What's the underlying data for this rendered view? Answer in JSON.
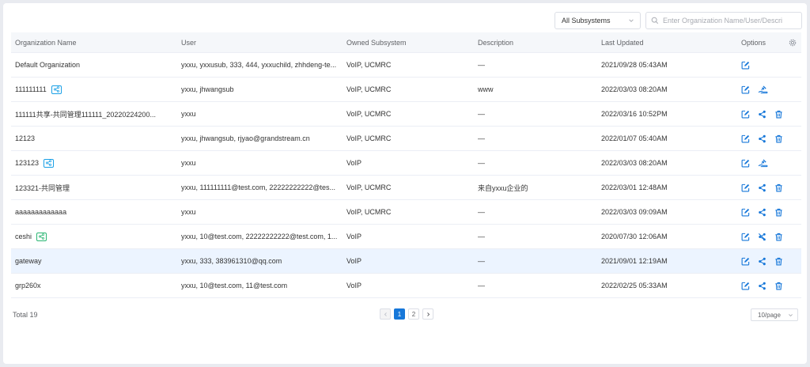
{
  "toolbar": {
    "subsystem_select": "All Subsystems",
    "search_placeholder": "Enter Organization Name/User/Descri"
  },
  "table": {
    "headers": {
      "org": "Organization Name",
      "user": "User",
      "subsystem": "Owned Subsystem",
      "description": "Description",
      "updated": "Last Updated",
      "options": "Options"
    },
    "rows": [
      {
        "name": "Default Organization",
        "badge": "",
        "user": "yxxu, yxxusub, 333, 444, yxxuchild, zhhdeng-te...",
        "subsystem": "VoIP, UCMRC",
        "description": "—",
        "updated": "2021/09/28 05:43AM",
        "actions": [
          "edit"
        ]
      },
      {
        "name": "111111111",
        "badge": "blue",
        "user": "yxxu, jhwangsub",
        "subsystem": "VoIP, UCMRC",
        "description": "www",
        "updated": "2022/03/03 08:20AM",
        "actions": [
          "edit",
          "handover"
        ]
      },
      {
        "name": "111111共享-共同管理111111_20220224200...",
        "badge": "",
        "user": "yxxu",
        "subsystem": "VoIP, UCMRC",
        "description": "—",
        "updated": "2022/03/16 10:52PM",
        "actions": [
          "edit",
          "share",
          "delete"
        ]
      },
      {
        "name": "12123",
        "badge": "",
        "user": "yxxu, jhwangsub, rjyao@grandstream.cn",
        "subsystem": "VoIP, UCMRC",
        "description": "—",
        "updated": "2022/01/07 05:40AM",
        "actions": [
          "edit",
          "share",
          "delete"
        ]
      },
      {
        "name": "123123",
        "badge": "blue",
        "user": "yxxu",
        "subsystem": "VoIP",
        "description": "—",
        "updated": "2022/03/03 08:20AM",
        "actions": [
          "edit",
          "handover"
        ]
      },
      {
        "name": "123321-共同管理",
        "badge": "",
        "user": "yxxu, 111111111@test.com, 22222222222@tes...",
        "subsystem": "VoIP, UCMRC",
        "description": "来自yxxu企业的",
        "updated": "2022/03/01 12:48AM",
        "actions": [
          "edit",
          "share",
          "delete"
        ]
      },
      {
        "name": "aaaaaaaaaaaaa",
        "badge": "",
        "user": "yxxu",
        "subsystem": "VoIP, UCMRC",
        "description": "—",
        "updated": "2022/03/03 09:09AM",
        "actions": [
          "edit",
          "share",
          "delete"
        ]
      },
      {
        "name": "ceshi",
        "badge": "green",
        "user": "yxxu, 10@test.com, 22222222222@test.com, 1...",
        "subsystem": "VoIP",
        "description": "—",
        "updated": "2020/07/30 12:06AM",
        "actions": [
          "edit",
          "unshare",
          "delete"
        ]
      },
      {
        "name": "gateway",
        "badge": "",
        "user": "yxxu, 333, 383961310@qq.com",
        "subsystem": "VoIP",
        "description": "—",
        "updated": "2021/09/01 12:19AM",
        "actions": [
          "edit",
          "share",
          "delete"
        ]
      },
      {
        "name": "grp260x",
        "badge": "",
        "user": "yxxu, 10@test.com, 11@test.com",
        "subsystem": "VoIP",
        "description": "—",
        "updated": "2022/02/25 05:33AM",
        "actions": [
          "edit",
          "share",
          "delete"
        ]
      }
    ],
    "highlighted_row": 8
  },
  "footer": {
    "total": "Total 19",
    "pages": [
      "1",
      "2"
    ],
    "current_page": "1",
    "page_size": "10/page"
  },
  "colors": {
    "accent": "#1677d9",
    "badge_blue": "#1aa0e6",
    "badge_green": "#2bb673",
    "row_highlight": "#ecf4ff"
  }
}
